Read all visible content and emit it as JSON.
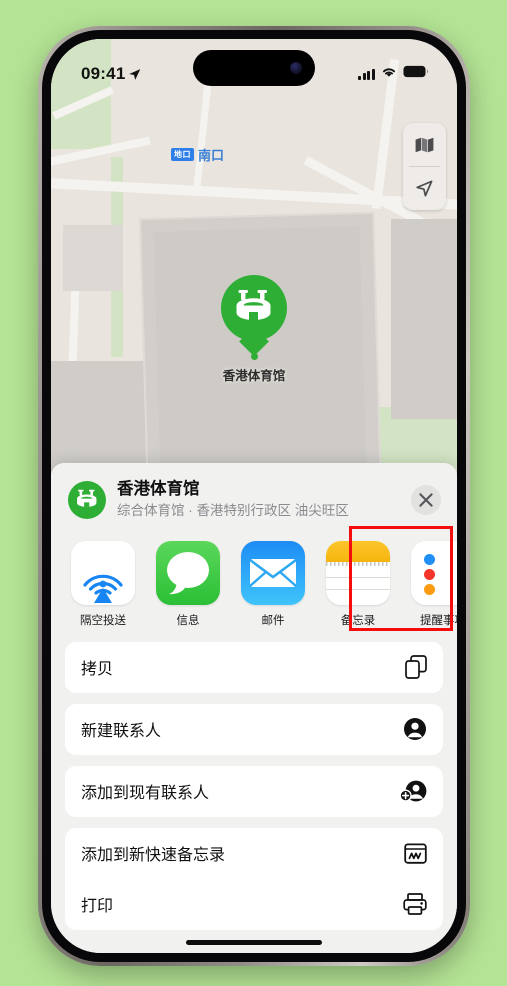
{
  "status_bar": {
    "time": "09:41",
    "location_arrow": "location-arrow-icon",
    "cellular": "signal-bars-icon",
    "wifi": "wifi-icon",
    "battery": "battery-icon"
  },
  "map": {
    "transit_badge": "地口",
    "transit_label": "南口",
    "pin_label": "香港体育馆",
    "pin_color": "#2fae36",
    "controls": [
      {
        "name": "map-mode-button",
        "icon": "map-layers-icon"
      },
      {
        "name": "locate-me-button",
        "icon": "location-arrow-icon"
      }
    ]
  },
  "share_sheet": {
    "title": "香港体育馆",
    "subtitle": "综合体育馆 · 香港特别行政区 油尖旺区",
    "close_label": "✕",
    "apps": [
      {
        "label": "隔空投送",
        "icon": "airdrop-icon",
        "highlighted": false
      },
      {
        "label": "信息",
        "icon": "messages-icon",
        "highlighted": false
      },
      {
        "label": "邮件",
        "icon": "mail-icon",
        "highlighted": false
      },
      {
        "label": "备忘录",
        "icon": "notes-icon",
        "highlighted": true
      },
      {
        "label": "提醒事项",
        "icon": "reminders-icon",
        "highlighted": false
      }
    ],
    "actions": [
      {
        "label": "拷贝",
        "icon": "copy-icon"
      },
      {
        "label": "新建联系人",
        "icon": "person-circle-icon"
      },
      {
        "label": "添加到现有联系人",
        "icon": "person-add-icon"
      },
      {
        "label": "添加到新快速备忘录",
        "icon": "quick-note-icon"
      },
      {
        "label": "打印",
        "icon": "printer-icon"
      }
    ]
  },
  "annotation": {
    "highlight_color": "#f40d0d",
    "target": "备忘录"
  }
}
